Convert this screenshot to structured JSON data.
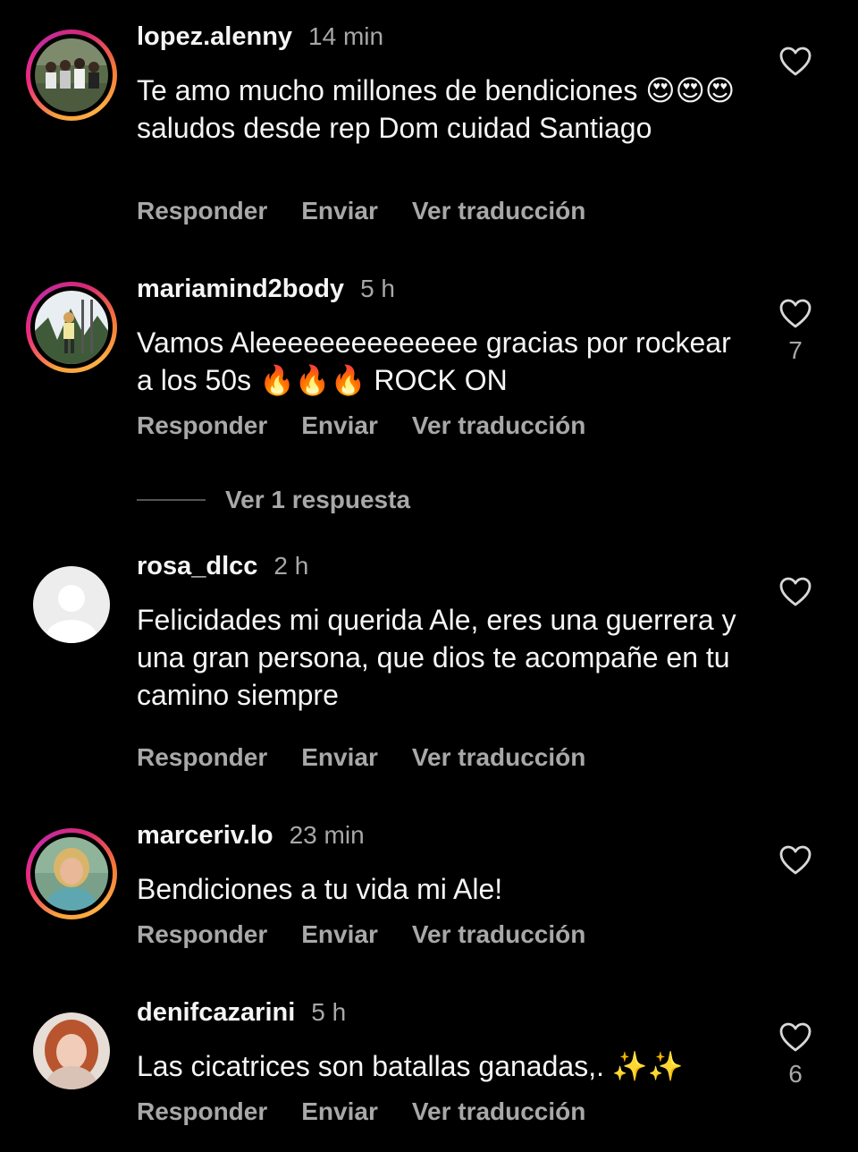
{
  "actions": {
    "reply": "Responder",
    "send": "Enviar",
    "translate": "Ver traducción"
  },
  "comments": [
    {
      "username": "lopez.alenny",
      "time": "14 min",
      "text": "Te amo mucho millones de bendiciones 😍😍😍 saludos desde rep Dom cuidad Santiago",
      "likes": "",
      "avatar_ring": true
    },
    {
      "username": "mariamind2body",
      "time": "5 h",
      "text": "Vamos Aleeeeeeeeeeeeee gracias por rockear a los 50s 🔥🔥🔥 ROCK ON",
      "likes": "7",
      "avatar_ring": true
    },
    {
      "username": "rosa_dlcc",
      "time": "2 h",
      "text": "Felicidades mi querida Ale, eres una guerrera y una gran persona, que dios te acompañe en tu camino siempre",
      "likes": "",
      "avatar_ring": false
    },
    {
      "username": "marceriv.lo",
      "time": "23 min",
      "text": "Bendiciones a tu vida mi Ale!",
      "likes": "",
      "avatar_ring": true
    },
    {
      "username": "denifcazarini",
      "time": "5 h",
      "text": "Las cicatrices son batallas ganadas,. ✨✨",
      "likes": "6",
      "avatar_ring": false
    }
  ],
  "view_replies": "Ver 1 respuesta",
  "colors": {
    "background": "#000000",
    "text_primary": "#f5f5f5",
    "text_secondary": "#a8a8a8"
  },
  "icons": {
    "like": "heart-outline-icon",
    "avatar_placeholder": "default-user-icon"
  }
}
